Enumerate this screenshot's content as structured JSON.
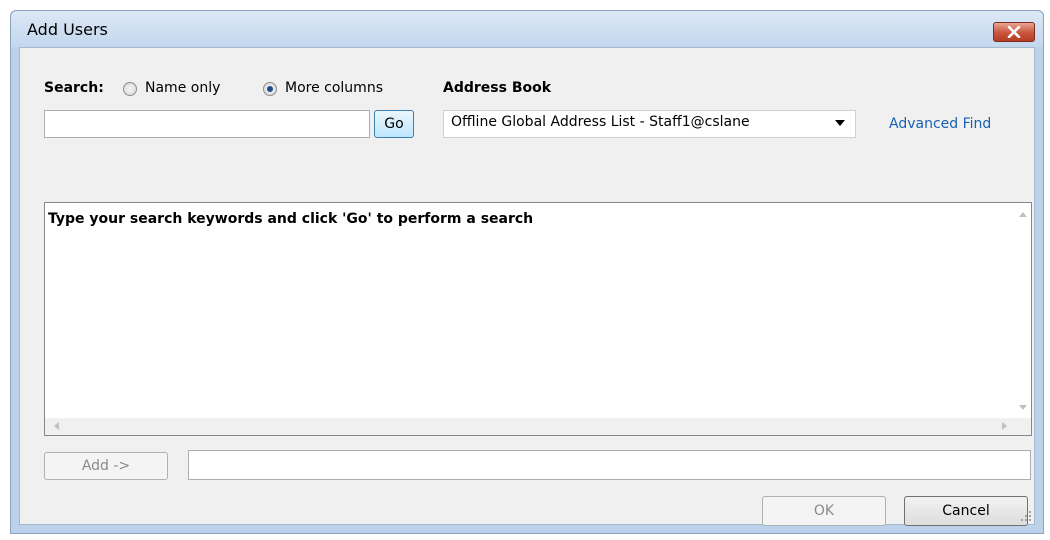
{
  "window": {
    "title": "Add Users"
  },
  "search": {
    "label": "Search:",
    "options": [
      "Name only",
      "More columns"
    ],
    "selected_option": "More columns",
    "query": "",
    "go_label": "Go"
  },
  "address_book": {
    "label": "Address Book",
    "selected": "Offline Global Address List - Staff1@cslane",
    "advanced_find": "Advanced Find"
  },
  "results": {
    "message": "Type your search keywords and click 'Go' to perform a search"
  },
  "add": {
    "button_label": "Add ->",
    "value": ""
  },
  "footer": {
    "ok_label": "OK",
    "cancel_label": "Cancel"
  },
  "icons": {
    "close": "close-icon",
    "dropdown": "chevron-down-icon",
    "scroll_up": "scroll-up-arrow-icon",
    "scroll_down": "scroll-down-arrow-icon",
    "scroll_left": "scroll-left-arrow-icon",
    "scroll_right": "scroll-right-arrow-icon",
    "resize": "resize-grip-icon"
  },
  "colors": {
    "title_bar": "#c4d7ee",
    "close_button": "#c7553c",
    "link": "#1a5fb4",
    "dialog_background": "#f0f0f0"
  }
}
